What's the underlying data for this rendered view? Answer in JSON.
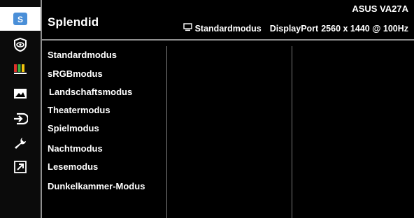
{
  "header": {
    "title": "Splendid",
    "model": "ASUS  VA27A",
    "status": {
      "mode": "Standardmodus",
      "input": "DisplayPort",
      "resolution": "2560 x 1440 @ 100Hz"
    }
  },
  "sidebar": {
    "items": [
      {
        "icon": "splendid-icon",
        "active": true
      },
      {
        "icon": "eye-care-icon",
        "active": false
      },
      {
        "icon": "color-bars-icon",
        "active": false
      },
      {
        "icon": "image-icon",
        "active": false
      },
      {
        "icon": "input-select-icon",
        "active": false
      },
      {
        "icon": "wrench-icon",
        "active": false
      },
      {
        "icon": "shortcut-icon",
        "active": false
      }
    ]
  },
  "menu": {
    "items": [
      {
        "label": "Standardmodus"
      },
      {
        "label": "sRGBmodus"
      },
      {
        "label": "Landschaftsmodus"
      },
      {
        "label": "Theatermodus"
      },
      {
        "label": "Spielmodus"
      },
      {
        "label": "Nachtmodus"
      },
      {
        "label": "Lesemodus"
      },
      {
        "label": "Dunkelkammer-Modus"
      }
    ]
  },
  "colors": {
    "accent": "#4a8fd8",
    "icon_red": "#e0322b",
    "icon_green": "#3cb043",
    "icon_yellow": "#f1c40f",
    "divider": "#8f8f8f"
  }
}
